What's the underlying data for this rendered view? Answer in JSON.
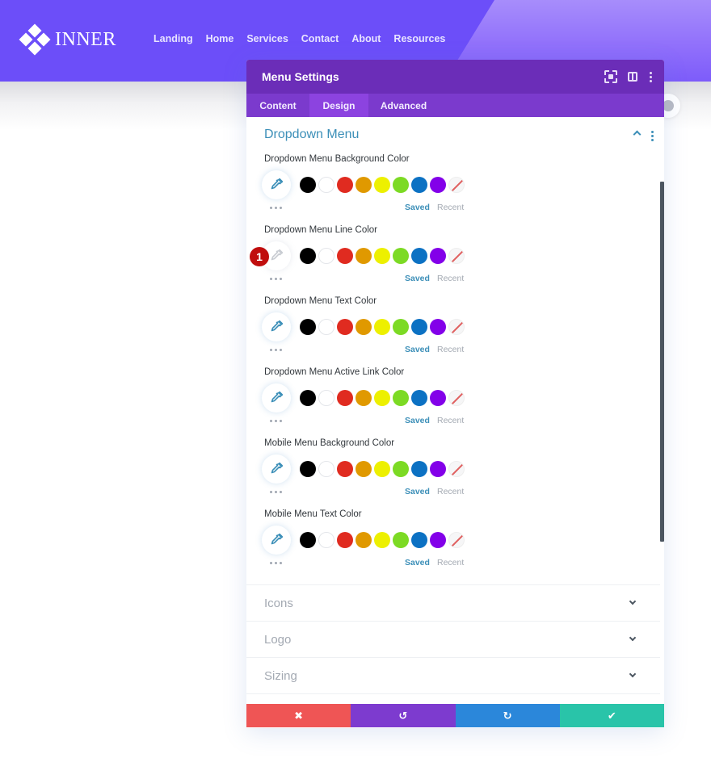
{
  "site": {
    "logo_text": "INNER",
    "nav": [
      "Landing",
      "Home",
      "Services",
      "Contact",
      "About",
      "Resources"
    ]
  },
  "panel": {
    "title": "Menu Settings",
    "header_icons": [
      "expand-icon",
      "split-view-icon",
      "more-options-icon"
    ],
    "tabs": [
      {
        "label": "Content",
        "active": false
      },
      {
        "label": "Design",
        "active": true
      },
      {
        "label": "Advanced",
        "active": false
      }
    ],
    "open_section": {
      "title": "Dropdown Menu",
      "fields": [
        {
          "label": "Dropdown Menu Background Color",
          "picker_active": true
        },
        {
          "label": "Dropdown Menu Line Color",
          "picker_active": false,
          "badge": "1"
        },
        {
          "label": "Dropdown Menu Text Color",
          "picker_active": true
        },
        {
          "label": "Dropdown Menu Active Link Color",
          "picker_active": true
        },
        {
          "label": "Mobile Menu Background Color",
          "picker_active": true
        },
        {
          "label": "Mobile Menu Text Color",
          "picker_active": true
        }
      ],
      "swatch_colors": [
        "#000000",
        "#ffffff",
        "#e02b20",
        "#e09900",
        "#edf000",
        "#7cda24",
        "#0c71c3",
        "#8300e9",
        "none"
      ],
      "saved_label": "Saved",
      "recent_label": "Recent"
    },
    "collapsed_sections": [
      "Icons",
      "Logo",
      "Sizing"
    ]
  },
  "footer": {
    "cancel": "✖",
    "undo": "↺",
    "redo": "↻",
    "save": "✔"
  },
  "colors": {
    "brand_purple": "#6c4ef9",
    "panel_header": "#6b2db8",
    "tabs_bg": "#7b3acd",
    "accent_blue": "#3c8fb8",
    "cancel": "#ef5555",
    "undo": "#7d3bcf",
    "redo": "#2b87da",
    "save": "#29c4a9"
  }
}
